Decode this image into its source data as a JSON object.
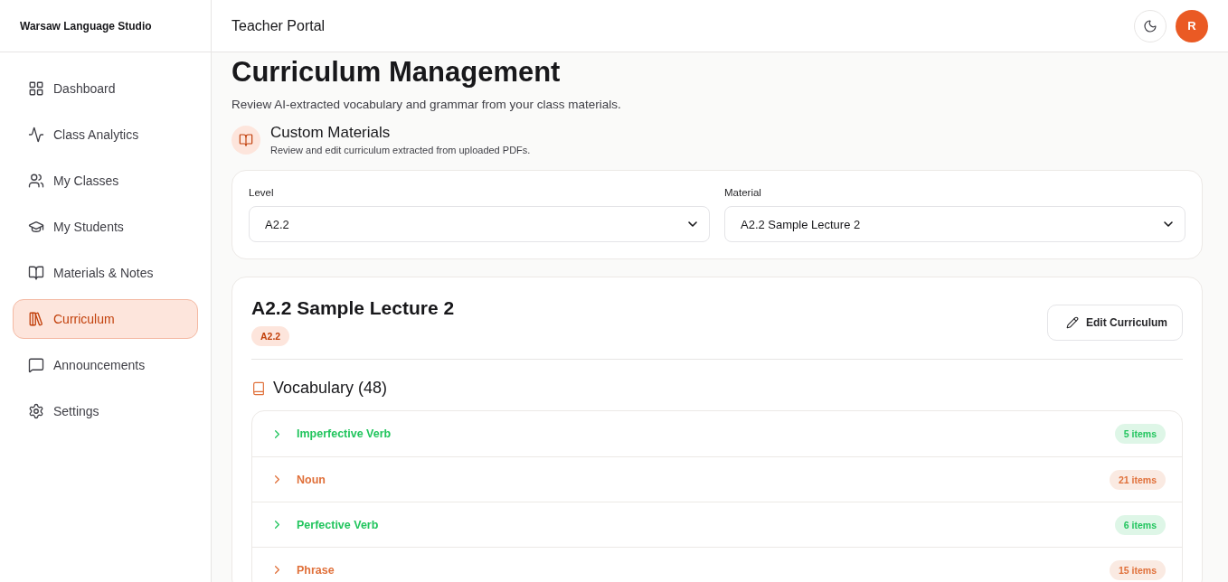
{
  "sidebar": {
    "brand": "Warsaw Language Studio",
    "items": [
      {
        "label": "Dashboard",
        "selected": false
      },
      {
        "label": "Class Analytics",
        "selected": false
      },
      {
        "label": "My Classes",
        "selected": false
      },
      {
        "label": "My Students",
        "selected": false
      },
      {
        "label": "Materials & Notes",
        "selected": false
      },
      {
        "label": "Curriculum",
        "selected": true
      },
      {
        "label": "Announcements",
        "selected": false
      },
      {
        "label": "Settings",
        "selected": false
      }
    ]
  },
  "header": {
    "title": "Teacher Portal",
    "avatar": "R"
  },
  "page": {
    "title": "Curriculum Management",
    "subtitle": "Review AI-extracted vocabulary and grammar from your class materials."
  },
  "section": {
    "title": "Custom Materials",
    "subtitle": "Review and edit curriculum extracted from uploaded PDFs."
  },
  "filters": [
    {
      "label": "Level",
      "value": "A2.2"
    },
    {
      "label": "Material",
      "value": "A2.2 Sample Lecture 2"
    }
  ],
  "material": {
    "title": "A2.2 Sample Lecture 2",
    "badge": "A2.2",
    "edit_button": "Edit Curriculum"
  },
  "vocabulary": {
    "title": "Vocabulary (48)",
    "groups": [
      {
        "label": "Imperfective Verb",
        "count": "5 items",
        "color": "#22c55e",
        "expanded": false
      },
      {
        "label": "Noun",
        "count": "21 items",
        "color": "#e0703a",
        "expanded": false
      },
      {
        "label": "Perfective Verb",
        "count": "6 items",
        "color": "#22c55e",
        "expanded": false
      },
      {
        "label": "Phrase",
        "count": "15 items",
        "color": "#e0703a",
        "expanded": false
      }
    ]
  }
}
